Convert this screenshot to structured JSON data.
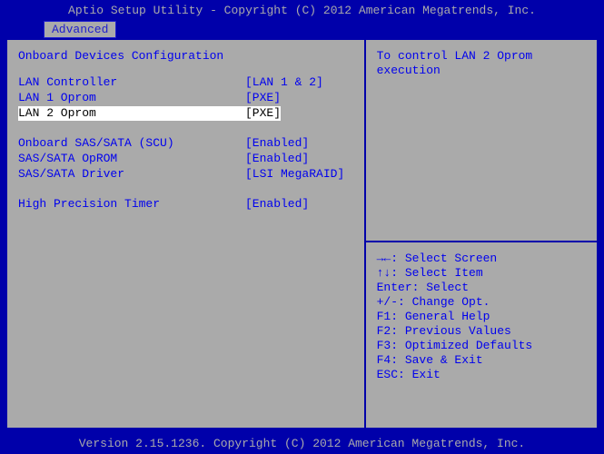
{
  "header": {
    "title": "Aptio Setup Utility - Copyright (C) 2012 American Megatrends, Inc."
  },
  "tabs": {
    "advanced": "Advanced"
  },
  "section": {
    "title": "Onboard Devices Configuration"
  },
  "settings": {
    "lan_controller": {
      "label": "LAN Controller",
      "value": "[LAN 1 & 2]"
    },
    "lan1_oprom": {
      "label": "LAN 1 Oprom",
      "value": "[PXE]"
    },
    "lan2_oprom": {
      "label": "LAN 2 Oprom",
      "value": "[PXE]"
    },
    "sas_sata_scu": {
      "label": "Onboard SAS/SATA (SCU)",
      "value": "[Enabled]"
    },
    "sas_sata_oprom": {
      "label": "SAS/SATA OpROM",
      "value": "[Enabled]"
    },
    "sas_sata_driver": {
      "label": "SAS/SATA Driver",
      "value": "[LSI MegaRAID]"
    },
    "hpt": {
      "label": "High Precision Timer",
      "value": "[Enabled]"
    }
  },
  "help": {
    "line1": "To control LAN 2 Oprom",
    "line2": "execution"
  },
  "nav": {
    "l1": "→←: Select Screen",
    "l2": "↑↓: Select Item",
    "l3": "Enter: Select",
    "l4": "+/-: Change Opt.",
    "l5": "F1: General Help",
    "l6": "F2: Previous Values",
    "l7": "F3: Optimized Defaults",
    "l8": "F4: Save & Exit",
    "l9": "ESC: Exit"
  },
  "footer": {
    "text": "Version 2.15.1236. Copyright (C) 2012 American Megatrends, Inc."
  }
}
